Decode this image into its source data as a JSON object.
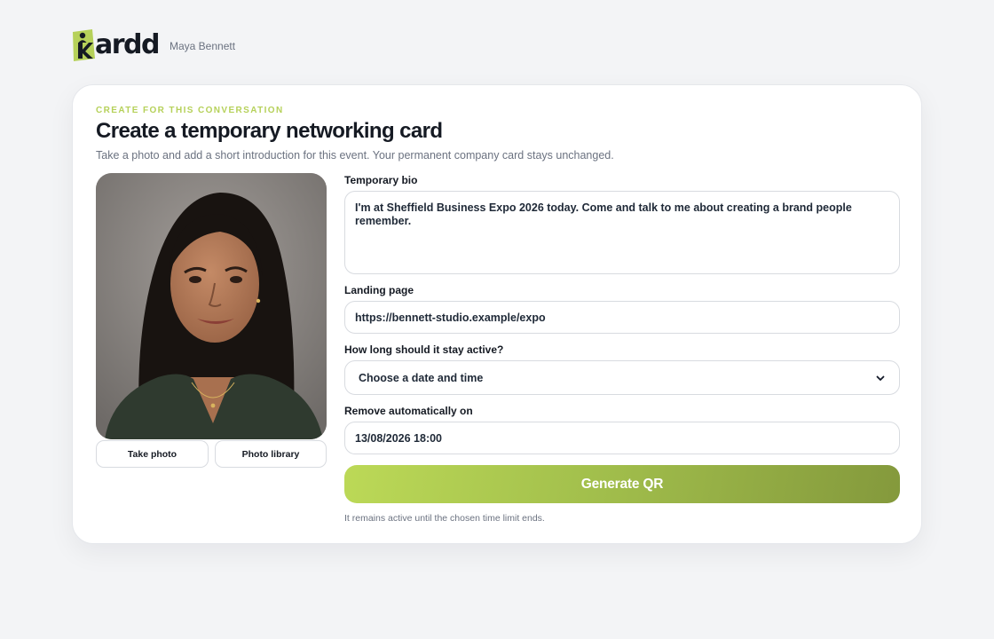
{
  "app": {
    "logo_text": "ardd",
    "user_name": "Maya Bennett",
    "brand_color": "#b6d15a"
  },
  "form": {
    "eyebrow": "CREATE FOR THIS CONVERSATION",
    "title": "Create a temporary networking card",
    "subtitle": "Take a photo and add a short introduction for this event. Your permanent company card stays unchanged.",
    "photo": {
      "take_photo_label": "Take photo",
      "photo_library_label": "Photo library"
    },
    "bio": {
      "label": "Temporary bio",
      "value": "I'm at Sheffield Business Expo 2026 today. Come and talk to me about creating a brand people remember."
    },
    "landing": {
      "label": "Landing page",
      "value": "https://bennett-studio.example/expo"
    },
    "duration": {
      "label": "How long should it stay active?",
      "selected": "Choose a date and time",
      "icon": "chevron-down-icon"
    },
    "remove": {
      "label": "Remove automatically on",
      "value": "13/08/2026 18:00"
    },
    "generate_label": "Generate QR",
    "note": "It remains active until the chosen time limit ends."
  }
}
